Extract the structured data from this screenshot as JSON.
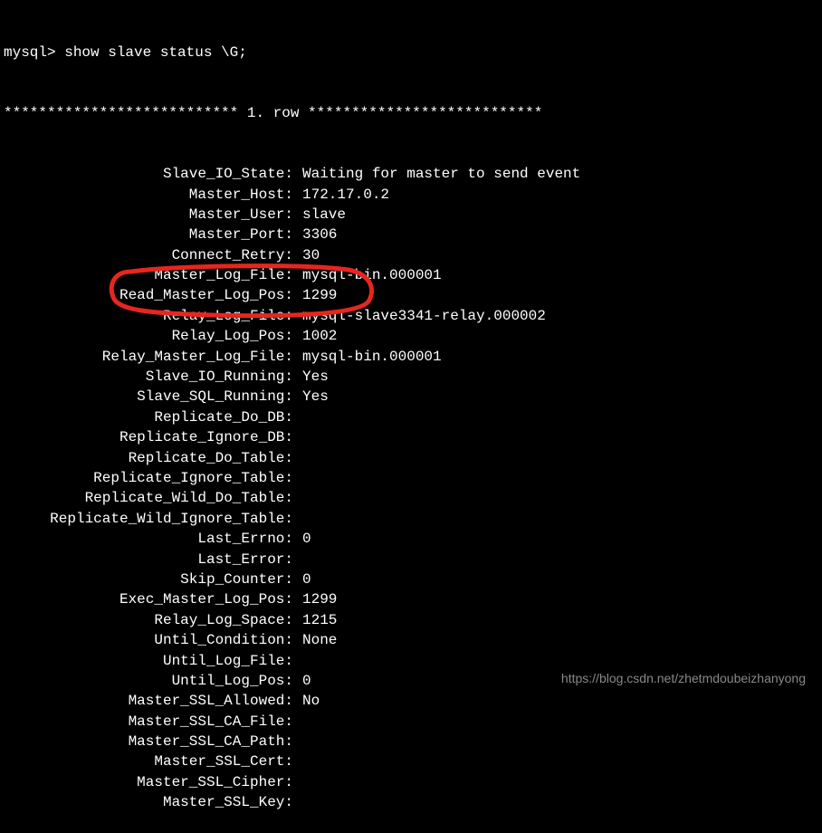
{
  "prompt": "mysql> ",
  "command": "show slave status \\G;",
  "row_separator": "*************************** 1. row ***************************",
  "fields": [
    {
      "label": "Slave_IO_State",
      "value": "Waiting for master to send event"
    },
    {
      "label": "Master_Host",
      "value": "172.17.0.2"
    },
    {
      "label": "Master_User",
      "value": "slave"
    },
    {
      "label": "Master_Port",
      "value": "3306"
    },
    {
      "label": "Connect_Retry",
      "value": "30"
    },
    {
      "label": "Master_Log_File",
      "value": "mysql-bin.000001"
    },
    {
      "label": "Read_Master_Log_Pos",
      "value": "1299"
    },
    {
      "label": "Relay_Log_File",
      "value": "mysql-slave3341-relay.000002"
    },
    {
      "label": "Relay_Log_Pos",
      "value": "1002"
    },
    {
      "label": "Relay_Master_Log_File",
      "value": "mysql-bin.000001"
    },
    {
      "label": "Slave_IO_Running",
      "value": "Yes"
    },
    {
      "label": "Slave_SQL_Running",
      "value": "Yes"
    },
    {
      "label": "Replicate_Do_DB",
      "value": ""
    },
    {
      "label": "Replicate_Ignore_DB",
      "value": ""
    },
    {
      "label": "Replicate_Do_Table",
      "value": ""
    },
    {
      "label": "Replicate_Ignore_Table",
      "value": ""
    },
    {
      "label": "Replicate_Wild_Do_Table",
      "value": ""
    },
    {
      "label": "Replicate_Wild_Ignore_Table",
      "value": ""
    },
    {
      "label": "Last_Errno",
      "value": "0"
    },
    {
      "label": "Last_Error",
      "value": ""
    },
    {
      "label": "Skip_Counter",
      "value": "0"
    },
    {
      "label": "Exec_Master_Log_Pos",
      "value": "1299"
    },
    {
      "label": "Relay_Log_Space",
      "value": "1215"
    },
    {
      "label": "Until_Condition",
      "value": "None"
    },
    {
      "label": "Until_Log_File",
      "value": ""
    },
    {
      "label": "Until_Log_Pos",
      "value": "0"
    },
    {
      "label": "Master_SSL_Allowed",
      "value": "No"
    },
    {
      "label": "Master_SSL_CA_File",
      "value": ""
    },
    {
      "label": "Master_SSL_CA_Path",
      "value": ""
    },
    {
      "label": "Master_SSL_Cert",
      "value": ""
    },
    {
      "label": "Master_SSL_Cipher",
      "value": ""
    },
    {
      "label": "Master_SSL_Key",
      "value": ""
    }
  ],
  "watermark": "https://blog.csdn.net/zhetmdoubeizhanyong",
  "annotation_color": "#e6261f",
  "colon": ":"
}
